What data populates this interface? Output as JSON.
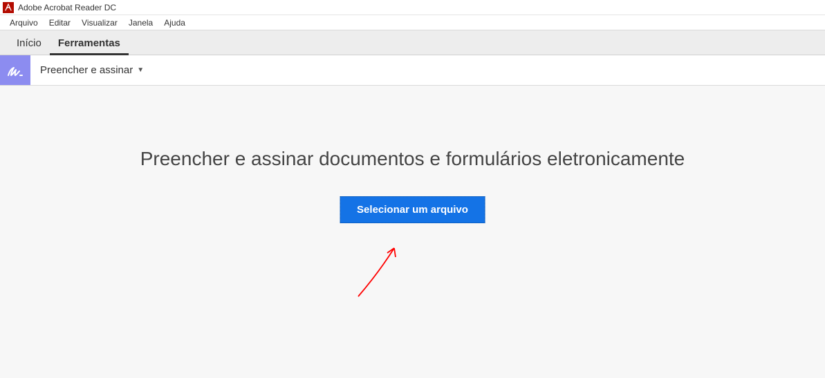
{
  "titlebar": {
    "app_name": "Adobe Acrobat Reader DC"
  },
  "menubar": {
    "items": [
      "Arquivo",
      "Editar",
      "Visualizar",
      "Janela",
      "Ajuda"
    ]
  },
  "tabs": {
    "inicio": "Início",
    "ferramentas": "Ferramentas"
  },
  "toolbar": {
    "fill_sign_label": "Preencher e assinar"
  },
  "main": {
    "heading": "Preencher e assinar documentos e formulários eletronicamente",
    "select_file_button": "Selecionar um arquivo"
  }
}
